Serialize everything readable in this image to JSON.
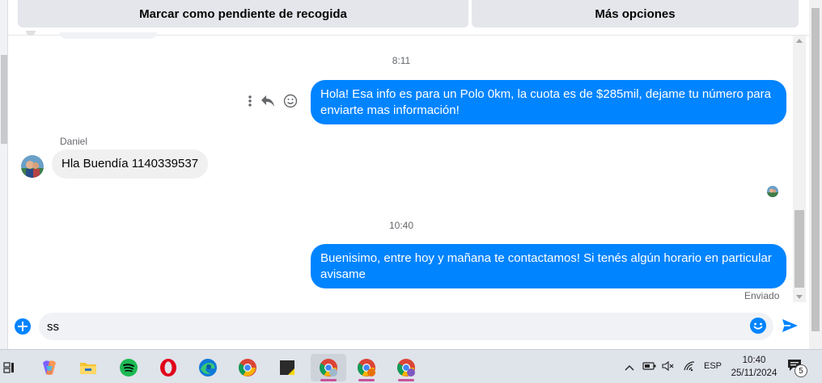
{
  "top_bar": {
    "mark_pending_label": "Marcar como pendiente de recogida",
    "more_options_label": "Más opciones"
  },
  "chat": {
    "messages": [
      {
        "type": "timestamp",
        "text": "8:11"
      },
      {
        "type": "outgoing",
        "text": "Hola! Esa info es para un Polo 0km, la cuota es de $285mil, dejame tu número para enviarte mas información!"
      },
      {
        "type": "incoming",
        "sender": "Daniel",
        "text": "Hla Buendía 1140339537"
      },
      {
        "type": "timestamp",
        "text": "10:40"
      },
      {
        "type": "outgoing",
        "text": "Buenisimo, entre hoy y mañana te contactamos! Si tenés algún horario en particular avisame"
      }
    ],
    "status": "Enviado"
  },
  "composer": {
    "value": "ss"
  },
  "taskbar": {
    "apps": [
      {
        "name": "copilot",
        "color": "#7b61ff"
      },
      {
        "name": "file-explorer",
        "color": "#f4c430"
      },
      {
        "name": "spotify",
        "color": "#1db954"
      },
      {
        "name": "opera",
        "color": "#e0001b"
      },
      {
        "name": "edge",
        "color": "#0f7ad8"
      },
      {
        "name": "chrome",
        "color": "#4285f4"
      },
      {
        "name": "sticky-notes",
        "color": "#333333"
      },
      {
        "name": "chrome-profile-a",
        "color": "#4285f4"
      },
      {
        "name": "chrome-profile-b",
        "color": "#4285f4"
      },
      {
        "name": "chrome-profile-c",
        "color": "#4285f4"
      }
    ],
    "language": "ESP",
    "time": "10:40",
    "date": "25/11/2024",
    "notification_count": "5"
  },
  "colors": {
    "accent": "#0084ff",
    "incoming_bubble": "#f0f0f0"
  }
}
